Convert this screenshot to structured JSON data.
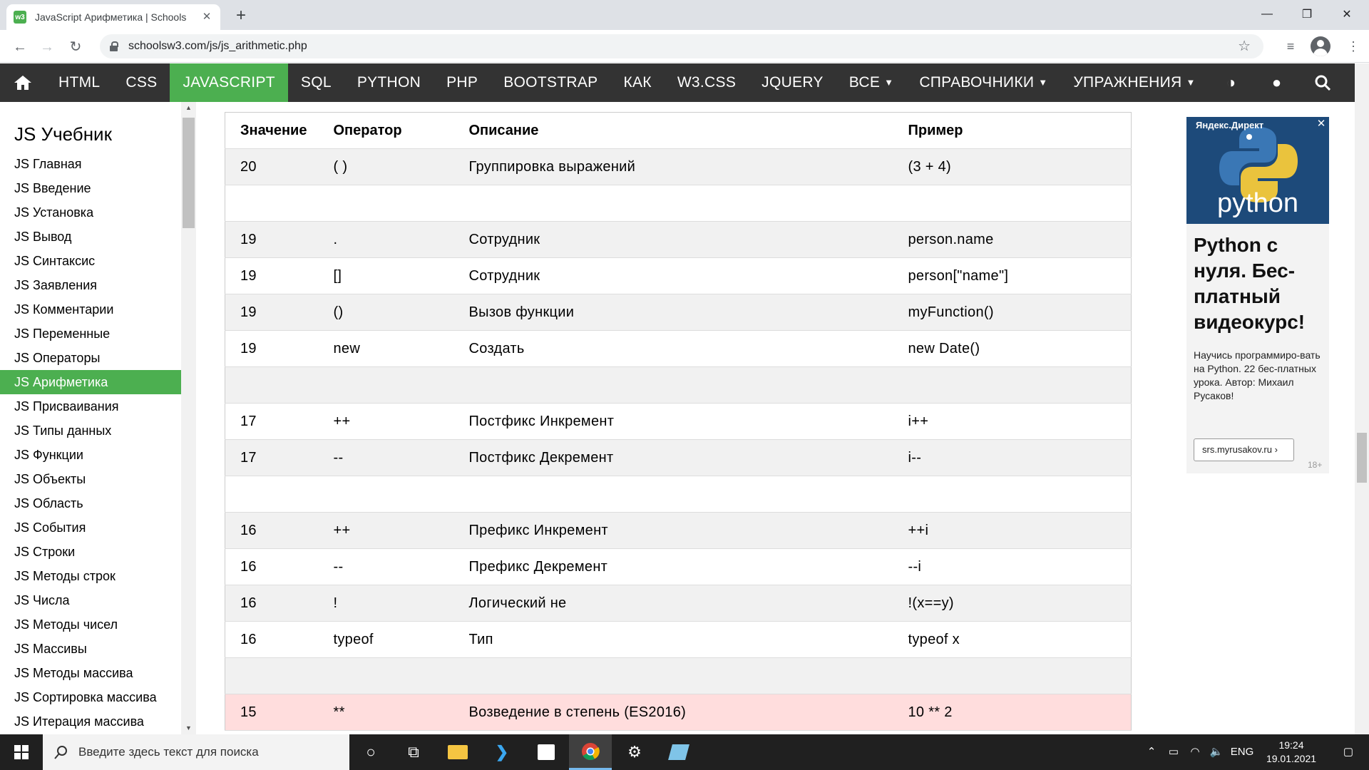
{
  "browser": {
    "tab_title": "JavaScript Арифметика | Schools",
    "url": "schoolsw3.com/js/js_arithmetic.php"
  },
  "topnav": {
    "items": [
      {
        "label": "HTML"
      },
      {
        "label": "CSS"
      },
      {
        "label": "JAVASCRIPT"
      },
      {
        "label": "SQL"
      },
      {
        "label": "PYTHON"
      },
      {
        "label": "PHP"
      },
      {
        "label": "BOOTSTRAP"
      },
      {
        "label": "КАК"
      },
      {
        "label": "W3.CSS"
      },
      {
        "label": "JQUERY"
      },
      {
        "label": "ВСЕ"
      },
      {
        "label": "СПРАВОЧНИКИ"
      },
      {
        "label": "УПРАЖНЕНИЯ"
      }
    ],
    "active": "JAVASCRIPT"
  },
  "sidebar": {
    "title": "JS Учебник",
    "items": [
      "JS Главная",
      "JS Введение",
      "JS Установка",
      "JS Вывод",
      "JS Синтаксис",
      "JS Заявления",
      "JS Комментарии",
      "JS Переменные",
      "JS Операторы",
      "JS Арифметика",
      "JS Присваивания",
      "JS Типы данных",
      "JS Функции",
      "JS Объекты",
      "JS Область",
      "JS События",
      "JS Строки",
      "JS Методы строк",
      "JS Числа",
      "JS Методы чисел",
      "JS Массивы",
      "JS Методы массива",
      "JS Сортировка массива",
      "JS Итерация массива"
    ],
    "active_item": "JS Арифметика"
  },
  "table": {
    "headers": [
      "Значение",
      "Оператор",
      "Описание",
      "Пример"
    ],
    "rows": [
      {
        "value": "20",
        "operator": "( )",
        "description": "Группировка выражений",
        "example": "(3 + 4)"
      },
      {
        "value": "",
        "operator": "",
        "description": "",
        "example": ""
      },
      {
        "value": "19",
        "operator": ".",
        "description": "Сотрудник",
        "example": "person.name"
      },
      {
        "value": "19",
        "operator": "[]",
        "description": "Сотрудник",
        "example": "person[\"name\"]"
      },
      {
        "value": "19",
        "operator": "()",
        "description": "Вызов функции",
        "example": "myFunction()"
      },
      {
        "value": "19",
        "operator": "new",
        "description": "Создать",
        "example": "new Date()"
      },
      {
        "value": "",
        "operator": "",
        "description": "",
        "example": ""
      },
      {
        "value": "17",
        "operator": "++",
        "description": "Постфикс Инкремент",
        "example": "i++"
      },
      {
        "value": "17",
        "operator": "--",
        "description": "Постфикс Декремент",
        "example": "i--"
      },
      {
        "value": "",
        "operator": "",
        "description": "",
        "example": ""
      },
      {
        "value": "16",
        "operator": "++",
        "description": "Префикс Инкремент",
        "example": "++i"
      },
      {
        "value": "16",
        "operator": "--",
        "description": "Префикс Декремент",
        "example": "--i"
      },
      {
        "value": "16",
        "operator": "!",
        "description": "Логический не",
        "example": "!(x==y)"
      },
      {
        "value": "16",
        "operator": "typeof",
        "description": "Тип",
        "example": "typeof x"
      },
      {
        "value": "",
        "operator": "",
        "description": "",
        "example": ""
      },
      {
        "value": "15",
        "operator": "**",
        "description": "Возведение в степень (ES2016)",
        "example": "10 ** 2",
        "highlight": true
      }
    ]
  },
  "ad": {
    "source": "Яндекс.Директ",
    "image_wordmark": "python",
    "headline": "Python с нуля. Бес-платный видеокурс!",
    "body": "Научись программиро-вать на Python. 22 бес-платных урока. Автор: Михаил Русаков!",
    "link": "srs.myrusakov.ru ›",
    "age": "18+"
  },
  "taskbar": {
    "search_placeholder": "Введите здесь текст для поиска",
    "language": "ENG",
    "time": "19:24",
    "date": "19.01.2021"
  },
  "colors": {
    "accent": "#4caf50",
    "nav_bg": "#333333",
    "highlight_row": "#ffdddd"
  }
}
